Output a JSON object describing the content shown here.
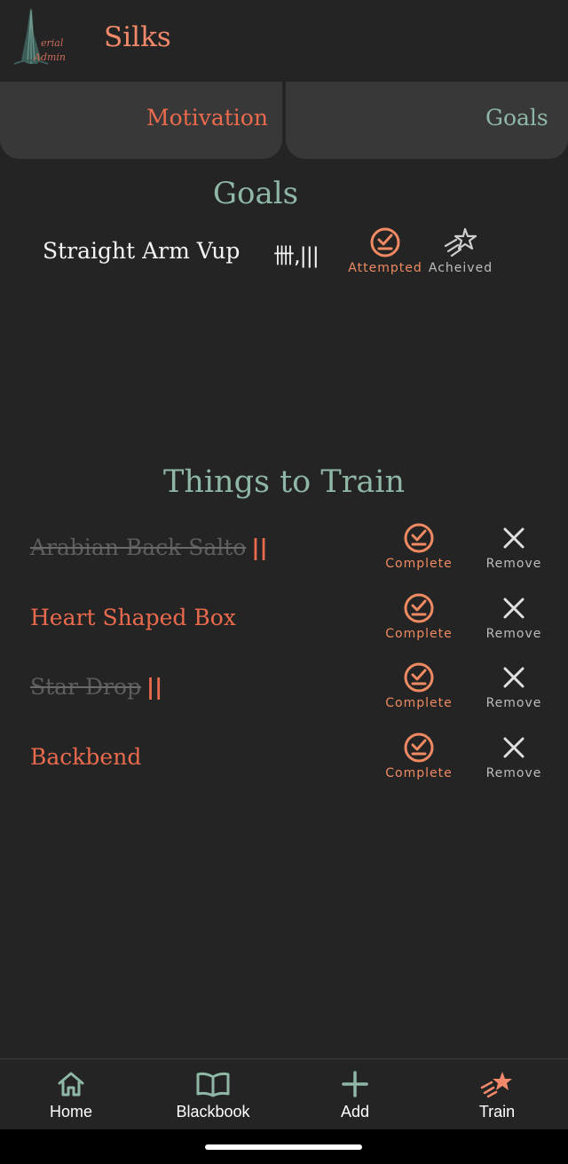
{
  "header": {
    "title": "Silks",
    "logo_text": "Aerial Admin"
  },
  "tabs": [
    {
      "label": "Motivation",
      "active": true
    },
    {
      "label": "Goals",
      "active": false
    }
  ],
  "goals": {
    "title": "Goals",
    "items": [
      {
        "name": "Straight Arm Vup",
        "tally": "卌,|||",
        "attempted_label": "Attempted",
        "achieved_label": "Acheived"
      }
    ]
  },
  "train": {
    "title": "Things to Train",
    "complete_label": "Complete",
    "remove_label": "Remove",
    "items": [
      {
        "name": "Arabian Back Salto",
        "marks": "||",
        "done": true
      },
      {
        "name": "Heart Shaped Box",
        "marks": "",
        "done": false
      },
      {
        "name": "Star Drop",
        "marks": "||",
        "done": true
      },
      {
        "name": "Backbend",
        "marks": "",
        "done": false
      }
    ]
  },
  "nav": [
    {
      "label": "Home",
      "icon": "home-icon"
    },
    {
      "label": "Blackbook",
      "icon": "book-icon"
    },
    {
      "label": "Add",
      "icon": "plus-icon"
    },
    {
      "label": "Train",
      "icon": "shooting-star-icon"
    }
  ],
  "colors": {
    "accent": "#ea6a4d",
    "teal": "#8fb7a6",
    "background": "#242424"
  }
}
